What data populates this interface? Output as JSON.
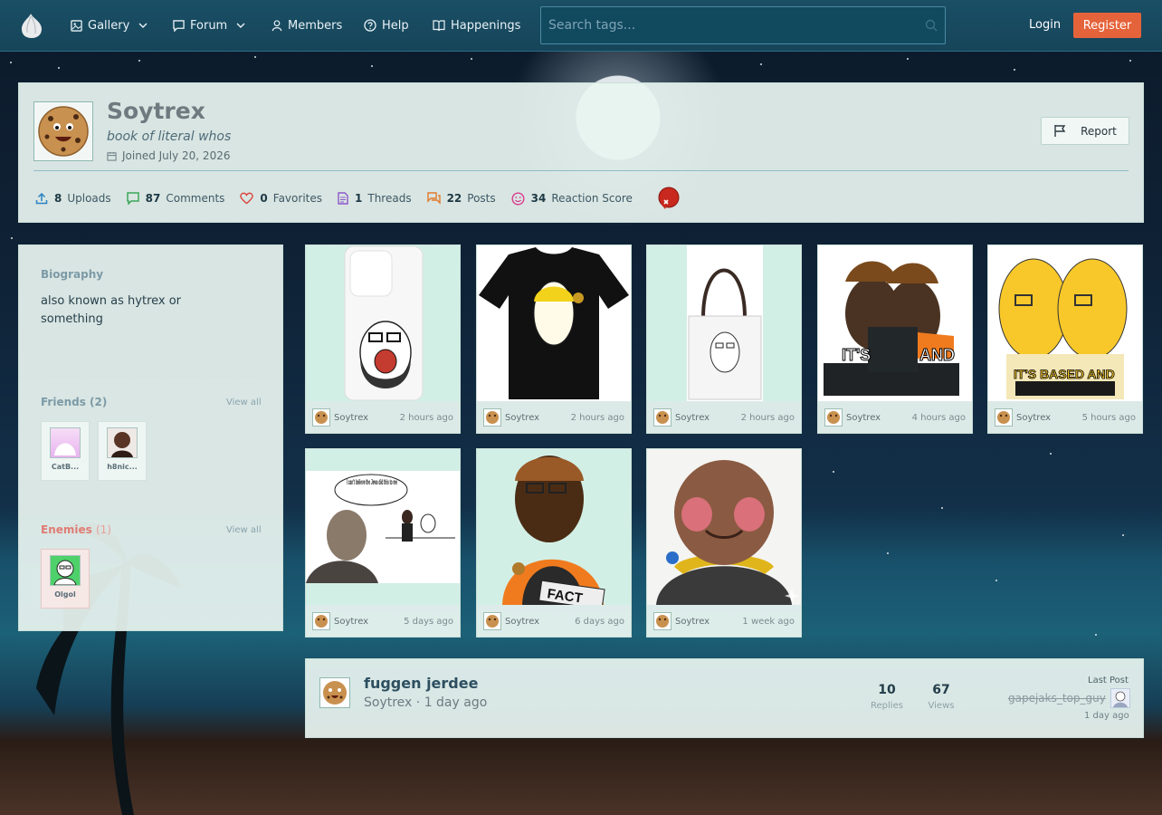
{
  "nav": {
    "items": [
      {
        "label": "Gallery",
        "icon": "image-icon",
        "has_dropdown": true
      },
      {
        "label": "Forum",
        "icon": "chat-icon",
        "has_dropdown": true
      },
      {
        "label": "Members",
        "icon": "user-icon",
        "has_dropdown": false
      },
      {
        "label": "Help",
        "icon": "question-icon",
        "has_dropdown": false
      },
      {
        "label": "Happenings",
        "icon": "book-icon",
        "has_dropdown": false
      }
    ],
    "search_placeholder": "Search tags...",
    "login_label": "Login",
    "register_label": "Register",
    "register_color": "#e5633a"
  },
  "profile": {
    "username": "Soytrex",
    "tagline": "book of literal whos",
    "joined": "Joined July 20, 2026",
    "report_label": "Report",
    "stats": [
      {
        "value": "8",
        "label": "Uploads",
        "icon": "upload-icon",
        "color": "#2a83c4"
      },
      {
        "value": "87",
        "label": "Comments",
        "icon": "comment-icon",
        "color": "#3aa65a"
      },
      {
        "value": "0",
        "label": "Favorites",
        "icon": "heart-icon",
        "color": "#d9443d"
      },
      {
        "value": "1",
        "label": "Threads",
        "icon": "document-icon",
        "color": "#8a59c9"
      },
      {
        "value": "22",
        "label": "Posts",
        "icon": "posts-icon",
        "color": "#e27a2a"
      },
      {
        "value": "34",
        "label": "Reaction Score",
        "icon": "smile-icon",
        "color": "#d93b8f"
      }
    ]
  },
  "sidebar": {
    "biography_title": "Biography",
    "biography_text": "also known as hytrex or something",
    "friends_title": "Friends (2)",
    "friends_link": "View all",
    "friends": [
      {
        "name": "CatB..."
      },
      {
        "name": "h8nic..."
      }
    ],
    "enemies_title": "Enemies",
    "enemies_count": "(1)",
    "enemies_link": "View all",
    "enemies": [
      {
        "name": "Olgol"
      }
    ]
  },
  "gallery": [
    {
      "user": "Soytrex",
      "time": "2 hours ago"
    },
    {
      "user": "Soytrex",
      "time": "2 hours ago"
    },
    {
      "user": "Soytrex",
      "time": "2 hours ago"
    },
    {
      "user": "Soytrex",
      "time": "4 hours ago"
    },
    {
      "user": "Soytrex",
      "time": "5 hours ago"
    },
    {
      "user": "Soytrex",
      "time": "5 days ago"
    },
    {
      "user": "Soytrex",
      "time": "6 days ago"
    },
    {
      "user": "Soytrex",
      "time": "1 week ago"
    }
  ],
  "gallery_text": {
    "meme_its": "IT'S",
    "meme_and": "AND",
    "meme_based": "IT'S BASED AND",
    "meme_caption": "I can't believe the Jews did this to me",
    "fact": "FACT"
  },
  "thread": {
    "title": "fuggen jerdee",
    "author": "Soytrex",
    "time": "1 day ago",
    "replies": "10",
    "replies_label": "Replies",
    "views": "67",
    "views_label": "Views",
    "last_post_label": "Last Post",
    "last_post_user": "gapejaks_top_guy",
    "last_post_time": "1 day ago"
  }
}
